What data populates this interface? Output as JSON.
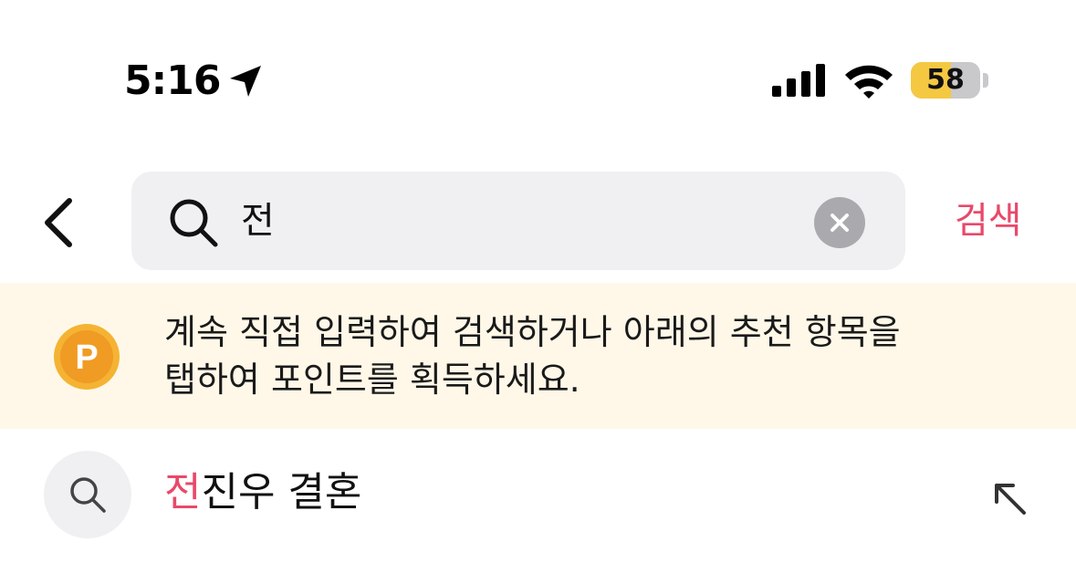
{
  "status_bar": {
    "time": "5:16",
    "battery": "58",
    "battery_color": "#f5c842",
    "icons": [
      "location-arrow-icon",
      "cellular-signal-icon",
      "wifi-icon",
      "battery-icon"
    ]
  },
  "search": {
    "back_icon": "chevron-left-icon",
    "search_icon": "search-icon",
    "query": "전",
    "clear_icon": "clear-x-icon",
    "submit_label": "검색",
    "accent_color": "#e8496a"
  },
  "banner": {
    "icon": "points-coin-icon",
    "icon_letter": "P",
    "line1": "계속 직접 입력하여 검색하거나 아래의 추천 항목을",
    "line2": "탭하여 포인트를 획득하세요."
  },
  "suggestions": [
    {
      "icon": "search-icon",
      "match": "전",
      "rest": "진우 결혼",
      "action_icon": "fill-arrow-icon"
    }
  ]
}
